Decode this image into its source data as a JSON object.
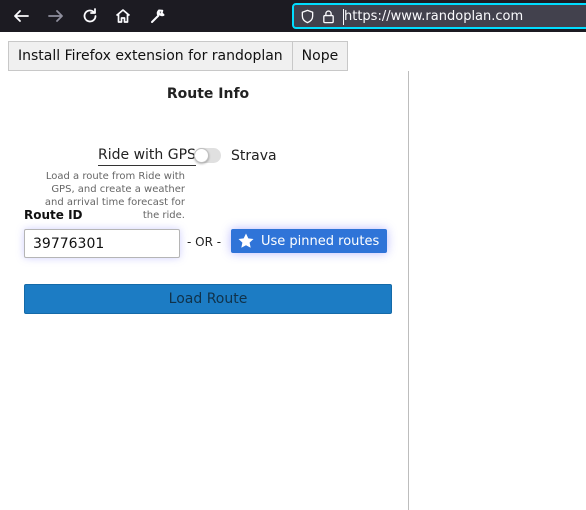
{
  "browser": {
    "url": "https://www.randoplan.com",
    "icons": [
      "back-icon",
      "forward-icon",
      "reload-icon",
      "home-icon",
      "wrench-icon",
      "shield-icon",
      "lock-icon"
    ],
    "colors": {
      "toolbar": "#1c1b22",
      "urlbar": "#42414d",
      "focus_ring": "#00ddff"
    }
  },
  "notification": {
    "install_label": "Install Firefox extension for randoplan",
    "dismiss_label": "Nope"
  },
  "route_info": {
    "heading": "Route Info",
    "source_left_label": "Ride with GPS",
    "source_right_label": "Strava",
    "help_text": "Load a route from Ride with GPS, and create a weather and arrival time forecast for the ride.",
    "route_id_label": "Route ID",
    "route_id_value": "39776301",
    "or_text": "- OR -",
    "pinned_label": "Use pinned routes",
    "load_label": "Load Route",
    "colors": {
      "pinned_button": "#2f74d8",
      "load_button": "#1c7cc4"
    }
  }
}
